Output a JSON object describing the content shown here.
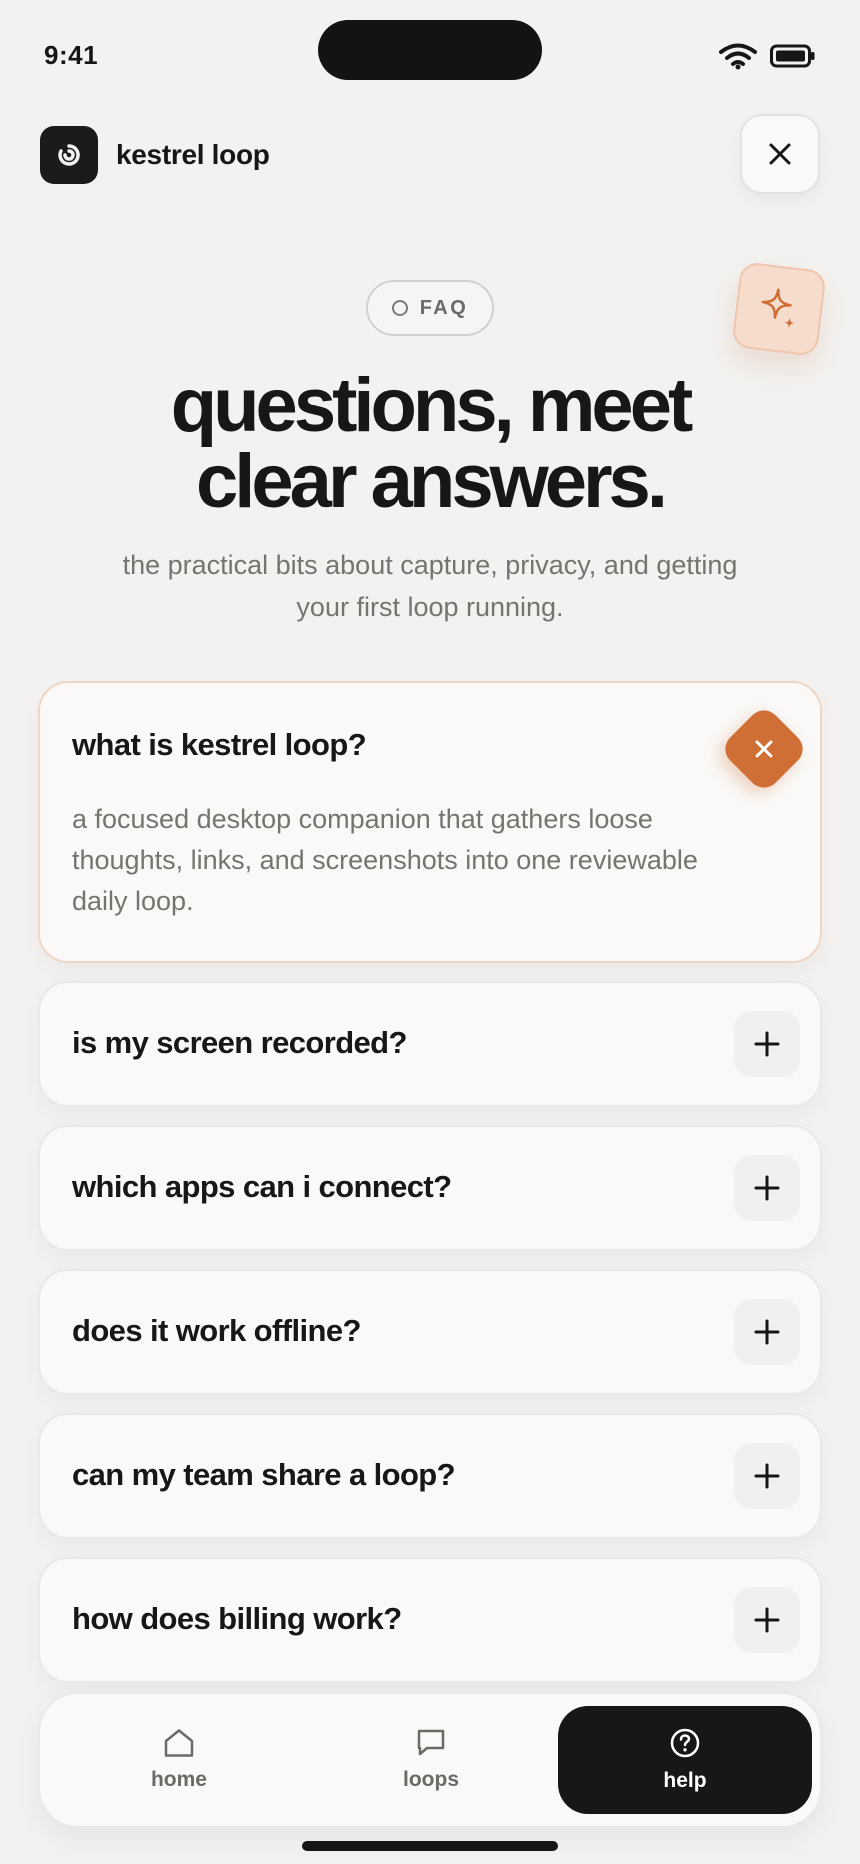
{
  "status_bar": {
    "time": "9:41"
  },
  "header": {
    "app_name": "kestrel loop"
  },
  "hero": {
    "badge": "FAQ",
    "title_line1": "questions, meet",
    "title_line2": "clear answers.",
    "subtitle": "the practical bits about capture, privacy, and getting your first loop running."
  },
  "faq": [
    {
      "question": "what is kestrel loop?",
      "answer": "a focused desktop companion that gathers loose thoughts, links, and screenshots into one reviewable daily loop.",
      "expanded": true
    },
    {
      "question": "is my screen recorded?",
      "expanded": false
    },
    {
      "question": "which apps can i connect?",
      "expanded": false
    },
    {
      "question": "does it work offline?",
      "expanded": false
    },
    {
      "question": "can my team share a loop?",
      "expanded": false
    },
    {
      "question": "how does billing work?",
      "expanded": false
    }
  ],
  "nav": {
    "items": [
      {
        "label": "home",
        "icon": "home-icon",
        "active": false
      },
      {
        "label": "loops",
        "icon": "chat-icon",
        "active": false
      },
      {
        "label": "help",
        "icon": "help-icon",
        "active": true
      }
    ]
  },
  "colors": {
    "accent": "#cf6f35",
    "accent_soft": "#f5dccc",
    "dark": "#171715",
    "background": "#f3f2f0"
  }
}
